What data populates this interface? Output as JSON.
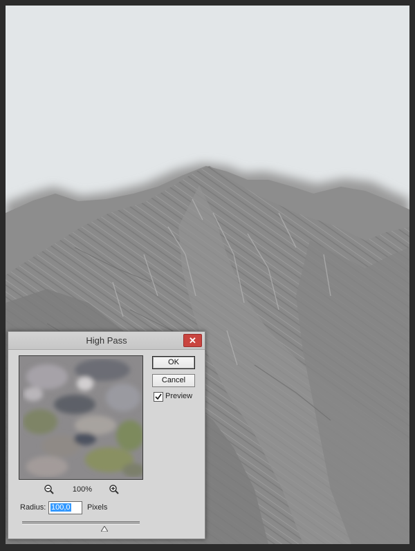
{
  "dialog": {
    "title": "High Pass",
    "close_label": "✕",
    "ok_label": "OK",
    "cancel_label": "Cancel",
    "preview_label": "Preview",
    "preview_checked": true,
    "zoom_level": "100%",
    "radius_label": "Radius:",
    "radius_value": "100,0",
    "radius_unit": "Pixels",
    "radius_slider_fraction": 0.7
  },
  "icons": {
    "close": "close-icon",
    "zoom_out": "zoom-out-icon",
    "zoom_in": "zoom-in-icon",
    "checkmark": "checkmark-icon",
    "slider_thumb": "slider-thumb-icon"
  },
  "colors": {
    "close_button": "#c9443f",
    "selection": "#3399ff",
    "canvas_sky": "#e2e6e8"
  }
}
